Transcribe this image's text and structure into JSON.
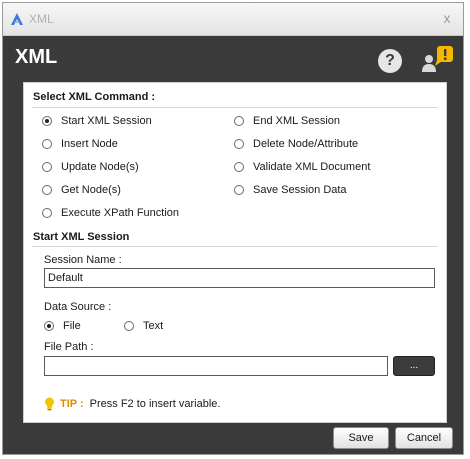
{
  "window": {
    "title": "XML",
    "close_glyph": "x"
  },
  "header": {
    "heading": "XML",
    "help_glyph": "?",
    "icons": [
      "help-icon",
      "user-alert-icon"
    ]
  },
  "command_section": {
    "title": "Select XML Command :",
    "selected": "Start XML Session",
    "options_left": [
      "Start XML Session",
      "Insert Node",
      "Update Node(s)",
      "Get Node(s)",
      "Execute XPath Function"
    ],
    "options_right": [
      "End XML Session",
      "Delete Node/Attribute",
      "Validate XML Document",
      "Save Session Data"
    ]
  },
  "session_section": {
    "title": "Start XML Session",
    "session_name_label": "Session Name :",
    "session_name_value": "Default",
    "data_source_label": "Data Source :",
    "data_source_options": [
      "File",
      "Text"
    ],
    "data_source_selected": "File",
    "file_path_label": "File Path :",
    "file_path_value": "",
    "browse_label": "..."
  },
  "tip": {
    "label": "TIP :",
    "text": "Press F2 to insert variable."
  },
  "footer": {
    "save_label": "Save",
    "cancel_label": "Cancel"
  },
  "colors": {
    "header_bg": "#3a3a3a",
    "tip_accent": "#e08a00",
    "alert_badge": "#f5b800",
    "app_icon": "#3a7bd5"
  }
}
